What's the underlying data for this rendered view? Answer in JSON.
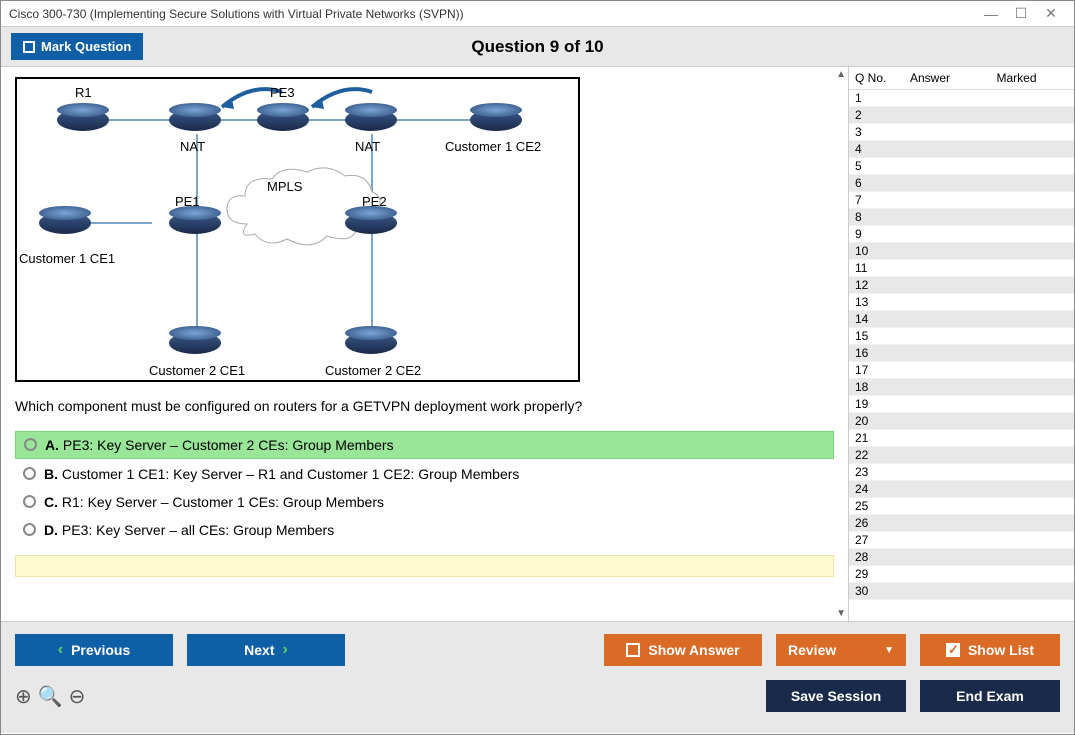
{
  "window": {
    "title": "Cisco 300-730 (Implementing Secure Solutions with Virtual Private Networks (SVPN))"
  },
  "toolbar": {
    "mark_label": "Mark Question",
    "counter": "Question 9 of 10"
  },
  "diagram": {
    "labels": {
      "r1": "R1",
      "pe3": "PE3",
      "nat1": "NAT",
      "nat2": "NAT",
      "cust1ce2": "Customer 1 CE2",
      "mpls": "MPLS",
      "pe1": "PE1",
      "pe2": "PE2",
      "cust1ce1": "Customer 1 CE1",
      "cust2ce1": "Customer 2 CE1",
      "cust2ce2": "Customer 2 CE2"
    }
  },
  "question": {
    "text": "Which component must be configured on routers for a GETVPN deployment work properly?",
    "options": [
      {
        "letter": "A.",
        "text": "PE3: Key Server – Customer 2 CEs: Group Members",
        "correct": true
      },
      {
        "letter": "B.",
        "text": "Customer 1 CE1: Key Server – R1 and Customer 1 CE2: Group Members",
        "correct": false
      },
      {
        "letter": "C.",
        "text": "R1: Key Server – Customer 1 CEs: Group Members",
        "correct": false
      },
      {
        "letter": "D.",
        "text": "PE3: Key Server – all CEs: Group Members",
        "correct": false
      }
    ]
  },
  "sidepanel": {
    "headers": {
      "qno": "Q No.",
      "answer": "Answer",
      "marked": "Marked"
    },
    "total": 30
  },
  "buttons": {
    "previous": "Previous",
    "next": "Next",
    "show_answer": "Show Answer",
    "review": "Review",
    "show_list": "Show List",
    "save_session": "Save Session",
    "end_exam": "End Exam"
  }
}
